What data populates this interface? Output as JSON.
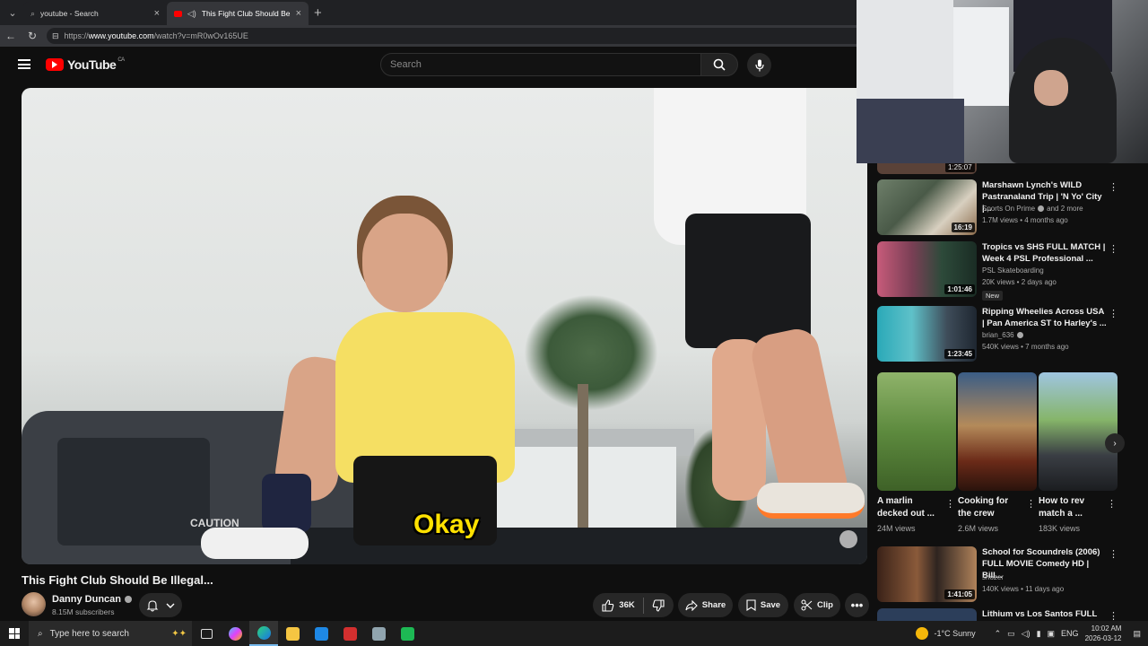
{
  "browser": {
    "tabs": [
      {
        "label": "youtube - Search",
        "active": false
      },
      {
        "label": "This Fight Club Should Be Ille",
        "active": true
      }
    ],
    "url_prefix": "https://",
    "url_host": "www.youtube.com",
    "url_path": "/watch?v=mR0wOv165UE"
  },
  "youtube": {
    "logo_text": "YouTube",
    "region": "CA",
    "search_placeholder": "Search"
  },
  "video": {
    "caption": "Okay",
    "title": "This Fight Club Should Be Illegal...",
    "truck_text": "CAUTION"
  },
  "channel": {
    "name": "Danny Duncan",
    "subscribers": "8.15M subscribers"
  },
  "actions": {
    "likes": "36K",
    "share": "Share",
    "save": "Save",
    "clip": "Clip"
  },
  "sidebar": {
    "prev_duration": "1:25:07",
    "items": [
      {
        "title": "Marshawn Lynch's WILD Pastranaland Trip | 'N Yo' City |...",
        "channel": "Sports On Prime",
        "extra": "and 2 more",
        "meta": "1.7M views • 4 months ago",
        "duration": "16:19"
      },
      {
        "title": "Tropics vs SHS  FULL MATCH | Week 4 PSL Professional ...",
        "channel": "PSL Skateboarding",
        "meta": "20K views • 2 days ago",
        "duration": "1:01:46",
        "badge": "New"
      },
      {
        "title": "Ripping Wheelies Across USA | Pan America ST to Harley's ...",
        "channel": "brian_636",
        "meta": "540K views • 7 months ago",
        "duration": "1:23:45"
      }
    ],
    "shorts": [
      {
        "title": "A marlin decked out ...",
        "views": "24M views"
      },
      {
        "title": "Cooking for the crew",
        "views": "2.6M views"
      },
      {
        "title": "How to rev match a ...",
        "views": "183K views"
      }
    ],
    "items2": [
      {
        "title": "School for Scoundrels (2006) FULL MOVIE Comedy HD | Bill...",
        "channel": "shozer",
        "meta": "140K views • 11 days ago",
        "duration": "1:41:05"
      },
      {
        "title": "Lithium vs Los Santos  FULL"
      }
    ]
  },
  "taskbar": {
    "search_placeholder": "Type here to search",
    "weather": "-1°C  Sunny",
    "lang": "ENG",
    "time": "10:02 AM",
    "date": "2026-03-12"
  }
}
